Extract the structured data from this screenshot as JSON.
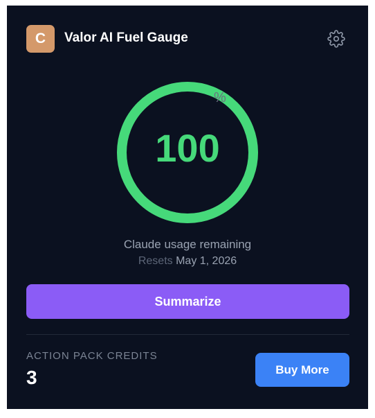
{
  "app": {
    "avatar_letter": "C",
    "title": "Valor AI Fuel Gauge",
    "settings_icon": "gear-icon"
  },
  "gauge": {
    "value": "100",
    "unit": "%",
    "fraction": 1.0,
    "caption": "Claude usage remaining",
    "resets_label": "Resets",
    "resets_date": "May 1, 2026"
  },
  "actions": {
    "summarize_label": "Summarize"
  },
  "credits": {
    "label": "ACTION PACK CREDITS",
    "value": "3",
    "buy_label": "Buy More"
  },
  "colors": {
    "panel": "#0b1120",
    "gauge": "#46d97a",
    "avatar": "#d4996a",
    "summarize": "#8b5cf6",
    "buy_more": "#3b82f6"
  }
}
